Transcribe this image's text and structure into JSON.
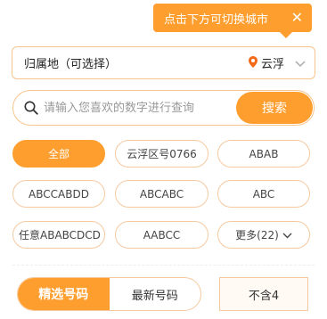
{
  "tooltip": {
    "text": "点击下方可切换城市",
    "close": "✕"
  },
  "region": {
    "label": "归属地（可选择）",
    "city": "云浮"
  },
  "search": {
    "placeholder": "请输入您喜欢的数字进行查询",
    "button": "搜索"
  },
  "filters": {
    "items": [
      "全部",
      "云浮区号0766",
      "ABAB",
      "ABCCABDD",
      "ABCABC",
      "ABC",
      "任意ABABCDCD",
      "AABCC"
    ],
    "more_label": "更多(22)"
  },
  "tabs": {
    "selected": "精选号码",
    "latest": "最新号码"
  },
  "exclude": {
    "label": "不含4"
  },
  "colors": {
    "accent": "#fe9e2e",
    "border": "#f5c9a0",
    "location_pin": "#f26b1d"
  }
}
